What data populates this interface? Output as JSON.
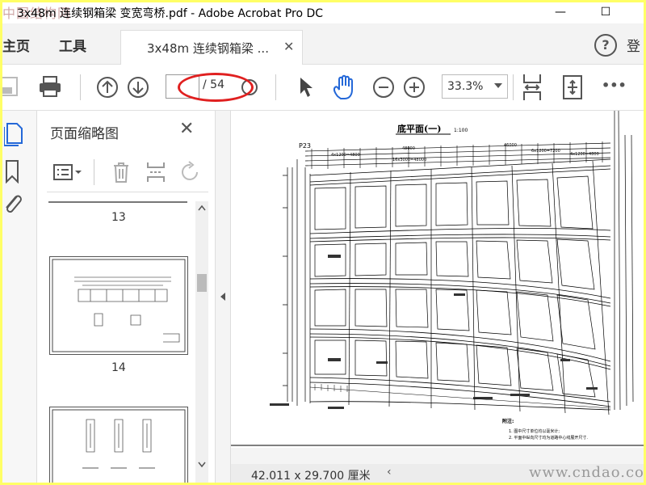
{
  "window": {
    "title": "3x48m 连续钢箱梁 变宽弯桥.pdf - Adobe Acrobat Pro DC",
    "minimize": "—",
    "maximize": "☐",
    "watermark_logo": "中国结构网"
  },
  "tabs": {
    "home": "主页",
    "tools": "工具",
    "document": "3x48m 连续钢箱梁 ...",
    "document_close": "✕",
    "help": "?",
    "signin": "登"
  },
  "toolbar": {
    "page_current": "",
    "page_total": "/ 54",
    "zoom": "33.3%",
    "more": "•••"
  },
  "thumbnail_pane": {
    "title": "页面缩略图",
    "close": "✕",
    "page_numbers": [
      "13",
      "14"
    ]
  },
  "drawing": {
    "title": "底平面(一)",
    "scale": "1:100",
    "pier_label": "P23",
    "notes_title": "附注:",
    "notes": [
      "1. 图中尺寸单位均以毫米计;",
      "2. 平面中纵向尺寸均为道路中心线展开尺寸."
    ],
    "dim_labels": [
      "48000",
      "46000",
      "4x1200=4800",
      "6x1200=7200",
      "16x3000=48000",
      "4x1200=4800"
    ]
  },
  "status": {
    "page_size": "42.011 x 29.700 厘米",
    "scroll_left": "‹",
    "watermark": "www.cndao.com"
  },
  "colors": {
    "frame_border": "#ffff66",
    "annotation_red": "#e02020",
    "icon_blue": "#2468d8"
  }
}
